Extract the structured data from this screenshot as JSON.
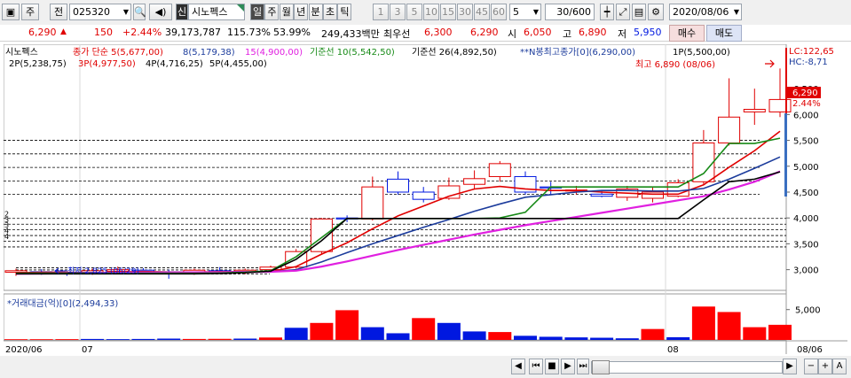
{
  "toolbar": {
    "market_label": "주",
    "period_label": "전",
    "code": "025320",
    "badge": "신",
    "name": "시노펙스",
    "intervals": [
      "일",
      "주",
      "월",
      "년",
      "분",
      "초",
      "틱"
    ],
    "active_interval": "일",
    "minute_nums": [
      "1",
      "3",
      "5",
      "10",
      "15",
      "30",
      "45",
      "60"
    ],
    "min_select": "5",
    "count": "30/600",
    "date": "2020/08/06"
  },
  "quote": {
    "price": "6,290",
    "arrow": "▲",
    "change": "150",
    "pct": "+2.44%",
    "volume": "39,173,787",
    "vol_ratio": "115.73%",
    "turnover": "53.99%",
    "value": "249,433백만",
    "best_label": "최우선",
    "best_ask": "6,300",
    "best_bid": "6,290",
    "open_label": "시",
    "open": "6,050",
    "high_label": "고",
    "high": "6,890",
    "low_label": "저",
    "low": "5,950",
    "buy_label": "매수",
    "sell_label": "매도"
  },
  "legend": {
    "name": "시노펙스",
    "close_simple": "종가 단순 5(5,677,00)",
    "ma8": "8(5,179,38)",
    "ma15": "15(4,900,00)",
    "base10": "기준선 10(5,542,50)",
    "base26": "기준선 26(4,892,50)",
    "nbong": "**N봉최고종가[0](6,290,00)",
    "p1": "1P(5,500,00)",
    "p2": "2P(5,238,75)",
    "p3": "3P(4,977,50)",
    "p4": "4P(4,716,25)",
    "p5": "5P(4,455,00)",
    "high_note": "최고 6,890 (08/06)",
    "low_note": "최저 2,825 (06/29)",
    "lc": "LC:122,65",
    "hc": "HC:-8,71",
    "last_price": "6,290",
    "last_pct": "2.44%",
    "vol_title": "*거래대금(억)[0](2,494,33)",
    "vol_tick": "5,000",
    "date_left": "2020/06",
    "date_07": "07",
    "date_08": "08",
    "date_right": "08/06"
  },
  "chart_data": {
    "type": "candlestick",
    "ylim": [
      2600,
      7050
    ],
    "yticks": [
      3000,
      3500,
      4000,
      4500,
      5000,
      5500,
      6000,
      6500
    ],
    "ytick_labels": [
      "3,000",
      "3,500",
      "4,000",
      "4,500",
      "5,000",
      "5,500",
      "6,000",
      "6,500"
    ],
    "candles": [
      {
        "o": 2950,
        "h": 3020,
        "l": 2880,
        "c": 2980
      },
      {
        "o": 2960,
        "h": 3010,
        "l": 2900,
        "c": 2940
      },
      {
        "o": 2940,
        "h": 2990,
        "l": 2880,
        "c": 2930
      },
      {
        "o": 2940,
        "h": 3020,
        "l": 2900,
        "c": 2980
      },
      {
        "o": 2970,
        "h": 3060,
        "l": 2920,
        "c": 3000
      },
      {
        "o": 2990,
        "h": 3030,
        "l": 2930,
        "c": 2960
      },
      {
        "o": 2960,
        "h": 3000,
        "l": 2825,
        "c": 2950
      },
      {
        "o": 2950,
        "h": 3020,
        "l": 2900,
        "c": 2990
      },
      {
        "o": 2980,
        "h": 3050,
        "l": 2930,
        "c": 2960
      },
      {
        "o": 2960,
        "h": 3020,
        "l": 2910,
        "c": 2990
      },
      {
        "o": 3000,
        "h": 3080,
        "l": 2960,
        "c": 3050
      },
      {
        "o": 3050,
        "h": 3400,
        "l": 3020,
        "c": 3350
      },
      {
        "o": 3350,
        "h": 4000,
        "l": 3300,
        "c": 3980
      },
      {
        "o": 4000,
        "h": 4050,
        "l": 3920,
        "c": 3980
      },
      {
        "o": 3980,
        "h": 4800,
        "l": 3950,
        "c": 4600
      },
      {
        "o": 4750,
        "h": 4900,
        "l": 4450,
        "c": 4500
      },
      {
        "o": 4500,
        "h": 4600,
        "l": 4300,
        "c": 4360
      },
      {
        "o": 4380,
        "h": 4780,
        "l": 4350,
        "c": 4620
      },
      {
        "o": 4650,
        "h": 4920,
        "l": 4550,
        "c": 4760
      },
      {
        "o": 4800,
        "h": 5100,
        "l": 4700,
        "c": 5050
      },
      {
        "o": 4800,
        "h": 4900,
        "l": 4450,
        "c": 4500
      },
      {
        "o": 4600,
        "h": 4700,
        "l": 4450,
        "c": 4580
      },
      {
        "o": 4520,
        "h": 4620,
        "l": 4450,
        "c": 4540
      },
      {
        "o": 4460,
        "h": 4530,
        "l": 4400,
        "c": 4420
      },
      {
        "o": 4400,
        "h": 4620,
        "l": 4330,
        "c": 4560
      },
      {
        "o": 4380,
        "h": 4600,
        "l": 4300,
        "c": 4500
      },
      {
        "o": 4420,
        "h": 4750,
        "l": 4400,
        "c": 4680
      },
      {
        "o": 4700,
        "h": 5700,
        "l": 4650,
        "c": 5450
      },
      {
        "o": 5450,
        "h": 6700,
        "l": 5400,
        "c": 5950
      },
      {
        "o": 6050,
        "h": 6500,
        "l": 5800,
        "c": 6100
      },
      {
        "o": 6050,
        "h": 6890,
        "l": 5950,
        "c": 6290
      }
    ],
    "series": [
      {
        "name": "5",
        "color": "#e00000",
        "values": [
          2940,
          2950,
          2950,
          2940,
          2955,
          2965,
          2955,
          2955,
          2960,
          2960,
          2960,
          3060,
          3300,
          3520,
          3790,
          4040,
          4230,
          4420,
          4560,
          4610,
          4560,
          4530,
          4530,
          4500,
          4480,
          4460,
          4460,
          4640,
          4980,
          5300,
          5677
        ]
      },
      {
        "name": "8",
        "color": "#1c3c9c",
        "values": [
          2930,
          2935,
          2940,
          2945,
          2945,
          2950,
          2950,
          2950,
          2955,
          2960,
          2960,
          3000,
          3150,
          3330,
          3500,
          3660,
          3820,
          3970,
          4130,
          4270,
          4400,
          4450,
          4500,
          4530,
          4530,
          4520,
          4520,
          4570,
          4750,
          4960,
          5179
        ]
      },
      {
        "name": "15",
        "color": "#e020e0",
        "values": [
          2920,
          2925,
          2930,
          2935,
          2940,
          2945,
          2945,
          2950,
          2950,
          2955,
          2960,
          2980,
          3060,
          3160,
          3270,
          3380,
          3480,
          3580,
          3680,
          3770,
          3860,
          3940,
          4020,
          4100,
          4180,
          4260,
          4340,
          4420,
          4550,
          4700,
          4900
        ]
      },
      {
        "name": "기준선 10",
        "color": "#178a17",
        "values": [
          2930,
          2930,
          2930,
          2930,
          2930,
          2930,
          2930,
          2930,
          2935,
          2950,
          2980,
          3250,
          3620,
          3990,
          3990,
          3990,
          3990,
          3990,
          3990,
          4000,
          4110,
          4600,
          4600,
          4600,
          4600,
          4600,
          4600,
          4860,
          5440,
          5440,
          5542
        ]
      },
      {
        "name": "기준선 26",
        "color": "#000000",
        "values": [
          2920,
          2920,
          2920,
          2920,
          2920,
          2920,
          2920,
          2920,
          2925,
          2940,
          2970,
          3200,
          3560,
          3990,
          3990,
          3990,
          3990,
          3990,
          3990,
          3990,
          3990,
          3990,
          3990,
          3990,
          3990,
          3990,
          3990,
          4350,
          4700,
          4750,
          4892
        ]
      }
    ],
    "pivot_levels": [
      5500,
      5238.75,
      4977.5,
      4716.25,
      4455
    ],
    "volume": {
      "ylim": [
        0,
        7000
      ],
      "values": [
        120,
        120,
        130,
        160,
        130,
        160,
        220,
        160,
        180,
        220,
        400,
        2000,
        2800,
        4900,
        2100,
        1100,
        3600,
        2800,
        1400,
        1300,
        680,
        520,
        420,
        360,
        270,
        1800,
        450,
        5500,
        4600,
        2100,
        2494
      ],
      "colors": [
        "r",
        "r",
        "r",
        "b",
        "b",
        "b",
        "b",
        "r",
        "r",
        "b",
        "r",
        "b",
        "r",
        "r",
        "b",
        "b",
        "r",
        "b",
        "b",
        "r",
        "b",
        "b",
        "b",
        "b",
        "b",
        "r",
        "b",
        "r",
        "r",
        "r",
        "r"
      ]
    },
    "colors": {
      "up": "#e00000",
      "down": "#0018e0",
      "up_fill": "#ffffff"
    }
  }
}
